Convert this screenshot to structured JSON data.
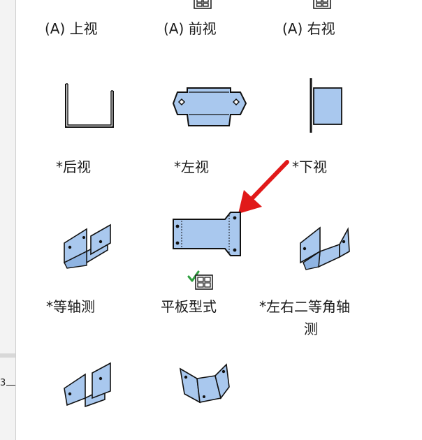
{
  "views": {
    "top": {
      "label": "(A) 上视"
    },
    "front": {
      "label": "(A) 前视"
    },
    "right": {
      "label": "(A) 右视"
    },
    "back": {
      "label": "*后视"
    },
    "left": {
      "label": "*左视"
    },
    "bottom": {
      "label": "*下视"
    },
    "isometric": {
      "label": "*等轴测"
    },
    "flat_pattern": {
      "label": "平板型式"
    },
    "dimetric_line1": {
      "label": "*左右二等角轴"
    },
    "dimetric_line2": {
      "label": "测"
    }
  },
  "left_strip": {
    "ruler_label": "3"
  },
  "colors": {
    "part_fill": "#a9c8ee",
    "part_stroke": "#111111",
    "arrow": "#e11919",
    "check": "#2e9e3e"
  }
}
